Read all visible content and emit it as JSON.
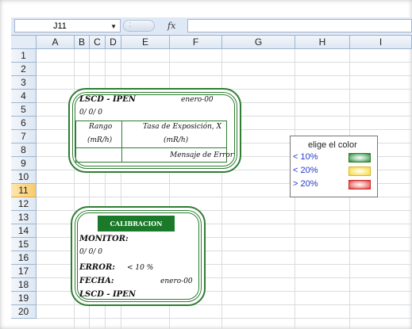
{
  "namebox": {
    "value": "J11"
  },
  "formula": {
    "fx_label": "fx",
    "content": ""
  },
  "columns": [
    "A",
    "B",
    "C",
    "D",
    "E",
    "F",
    "G",
    "H",
    "I"
  ],
  "rows": [
    "1",
    "2",
    "3",
    "4",
    "5",
    "6",
    "7",
    "8",
    "9",
    "10",
    "11",
    "12",
    "13",
    "14",
    "15",
    "16",
    "17",
    "18",
    "19",
    "20"
  ],
  "selected_row": "11",
  "card1": {
    "title": "LSCD - IPEN",
    "date": "enero-00",
    "date_line": "0/ 0/ 0",
    "rango_label": "Rango",
    "rango_unit": "(mR/h)",
    "tasa_label": "Tasa de Exposición, X",
    "tasa_unit": "(mR/h)",
    "error_msg": "Mensaje de Error"
  },
  "card2": {
    "button": "CALIBRACION",
    "monitor": "MONITOR:",
    "monitor_value": "0/ 0/ 0",
    "error_label": "ERROR:",
    "error_value": "< 10 %",
    "fecha_label": "FECHA:",
    "fecha_value": "enero-00",
    "footer": "LSCD - IPEN"
  },
  "legend": {
    "title": "elige el color",
    "items": [
      {
        "label": "< 10%",
        "color": "#2e7d32"
      },
      {
        "label": "< 20%",
        "color": "#f5d547"
      },
      {
        "label": "> 20%",
        "color": "#e53935"
      }
    ]
  }
}
